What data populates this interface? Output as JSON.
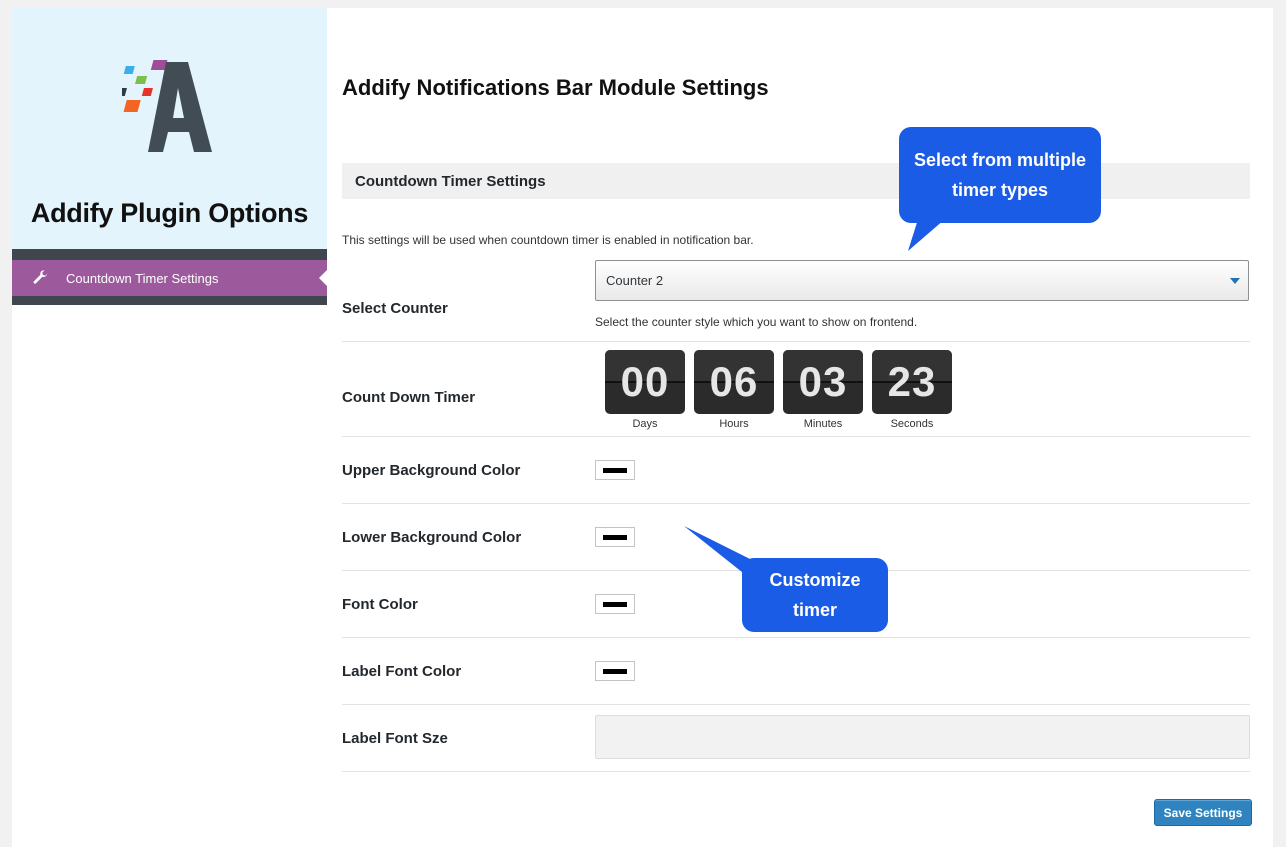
{
  "sidebar": {
    "title": "Addify Plugin Options",
    "nav_item": {
      "label": "Countdown Timer Settings",
      "icon": "wrench-icon"
    }
  },
  "main": {
    "title": "Addify Notifications Bar Module Settings",
    "section_title": "Countdown Timer Settings",
    "section_description": "This settings will be used when countdown timer is enabled in notification bar.",
    "select_counter": {
      "label": "Select Counter",
      "value": "Counter 2",
      "hint": "Select the counter style which you want to show on frontend."
    },
    "countdown": {
      "label": "Count Down Timer",
      "units": [
        {
          "value": "00",
          "label": "Days"
        },
        {
          "value": "06",
          "label": "Hours"
        },
        {
          "value": "03",
          "label": "Minutes"
        },
        {
          "value": "23",
          "label": "Seconds"
        }
      ]
    },
    "upper_bg": {
      "label": "Upper Background Color",
      "color": "#000000"
    },
    "lower_bg": {
      "label": "Lower Background Color",
      "color": "#000000"
    },
    "font_color": {
      "label": "Font Color",
      "color": "#000000"
    },
    "label_font_color": {
      "label": "Label Font Color",
      "color": "#000000"
    },
    "label_font_size": {
      "label": "Label Font Sze",
      "value": ""
    },
    "save_label": "Save Settings"
  },
  "callouts": {
    "top": "Select from multiple timer types",
    "bottom": "Customize timer"
  },
  "colors": {
    "accent_purple": "#9c5a9c",
    "sidebar_bg": "#e4f4fc",
    "callout_blue": "#1a5ce5",
    "button_blue": "#2f84c0"
  }
}
